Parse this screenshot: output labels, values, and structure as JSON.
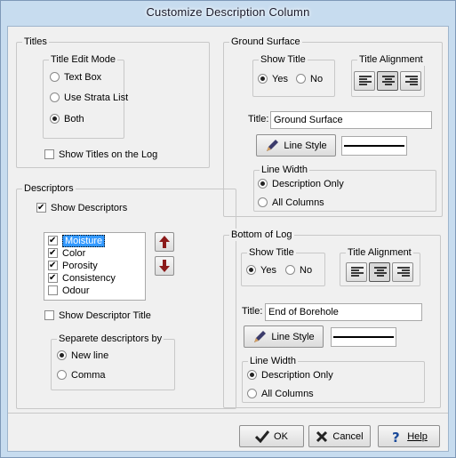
{
  "window": {
    "title": "Customize Description Column"
  },
  "titles_group": {
    "label": "Titles",
    "edit_mode": {
      "label": "Title Edit Mode",
      "options": [
        "Text Box",
        "Use Strata List",
        "Both"
      ],
      "selected": "Both"
    },
    "show_on_log": {
      "label": "Show Titles on the Log",
      "checked": false
    }
  },
  "descriptors_group": {
    "label": "Descriptors",
    "show_descriptors": {
      "label": "Show Descriptors",
      "checked": true
    },
    "items": [
      {
        "label": "Moisture",
        "checked": true,
        "selected": true
      },
      {
        "label": "Color",
        "checked": true
      },
      {
        "label": "Porosity",
        "checked": true
      },
      {
        "label": "Consistency",
        "checked": true
      },
      {
        "label": "Odour",
        "checked": false
      }
    ],
    "show_title": {
      "label": "Show Descriptor Title",
      "checked": false
    },
    "separate": {
      "label": "Separete descriptors  by",
      "options": [
        "New line",
        "Comma"
      ],
      "selected": "New line"
    }
  },
  "ground_surface": {
    "label": "Ground Surface",
    "show_title": {
      "label": "Show Title",
      "options": [
        "Yes",
        "No"
      ],
      "selected": "Yes"
    },
    "title_alignment": {
      "label": "Title Alignment",
      "selected": "center"
    },
    "title_label": "Title:",
    "title_value": "Ground Surface",
    "line_style_label": "Line Style",
    "line_width": {
      "label": "Line Width",
      "options": [
        "Description Only",
        "All Columns"
      ],
      "selected": "Description Only"
    }
  },
  "bottom_of_log": {
    "label": "Bottom of Log",
    "show_title": {
      "label": "Show Title",
      "options": [
        "Yes",
        "No"
      ],
      "selected": "Yes"
    },
    "title_alignment": {
      "label": "Title Alignment",
      "selected": "center"
    },
    "title_label": "Title:",
    "title_value": "End of Borehole",
    "line_style_label": "Line Style",
    "line_width": {
      "label": "Line Width",
      "options": [
        "Description Only",
        "All Columns"
      ],
      "selected": "Description Only"
    }
  },
  "buttons": {
    "ok": "OK",
    "cancel": "Cancel",
    "help": "Help"
  },
  "icons": {
    "ok": "checkmark-icon",
    "cancel": "x-icon",
    "help": "question-icon",
    "line_style": "pencil-icon",
    "move_up": "arrow-up-icon",
    "move_down": "arrow-down-icon"
  },
  "colors": {
    "frame": "#c7dcef",
    "selection": "#3399ff"
  }
}
